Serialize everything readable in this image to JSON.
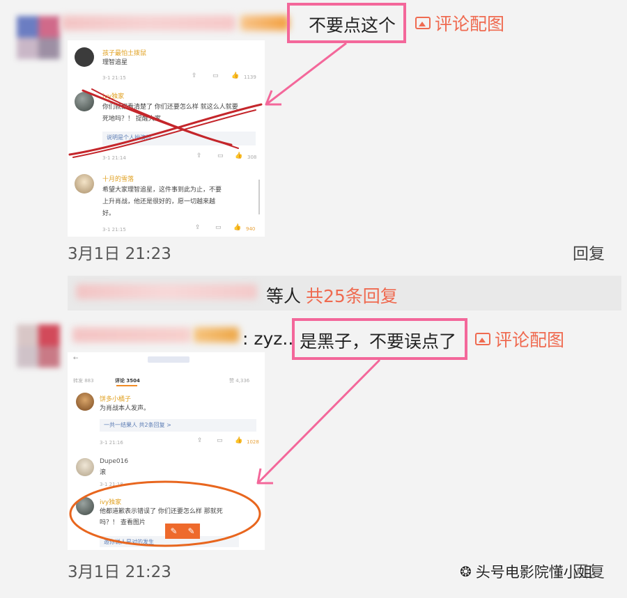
{
  "comment1": {
    "reply_text": "不要点这个",
    "pic_link": "评论配图",
    "date": "3月1日 21:23",
    "reply_button": "回复",
    "screenshot": {
      "items": [
        {
          "name": "孩子最怕土拨鼠",
          "text": "理智追星",
          "meta": "3-1 21:15",
          "likes": "1139"
        },
        {
          "name": "ivy独家",
          "text": "你们就都看清楚了 你们还要怎么样 就这么人就要",
          "text2": "死地吗？！ 提醒大家",
          "quote": "说明是个人扮演的",
          "meta": "3-1 21:14",
          "likes": "308"
        },
        {
          "name": "十月的雪落",
          "text": "希望大家理智追星，这件事到此为止，不要",
          "text2": "上升肖战，他还是很好的，愿一切越来越",
          "text3": "好。",
          "meta": "3-1 21:15",
          "likes": "940"
        }
      ]
    }
  },
  "replies_bar": {
    "suffix": "等人",
    "count": "共25条回复"
  },
  "comment2": {
    "prefix": ": zyz..",
    "reply_text": "是黑子，不要误点了",
    "pic_link": "评论配图",
    "date": "3月1日 21:23",
    "reply_button": "回复",
    "screenshot": {
      "tabs": [
        "转发 883",
        "评论 3504",
        "赞 4,336"
      ],
      "items": [
        {
          "name": "饼多小橘子",
          "text": "为肖战本人发声。",
          "quote": "一共一结果人 共2条回复 >",
          "meta": "3-1 21:16",
          "likes": "1028"
        },
        {
          "name": "Dupe016",
          "text": "滚",
          "meta": "3-1 21:18",
          "likes": ""
        },
        {
          "name": "ivy独家",
          "text": "他都道歉表示错误了 你们还要怎么样 那就死",
          "text2": "吗？！ 查看图片",
          "quote": "邀你说人是对的发生",
          "meta": "",
          "likes": ""
        }
      ]
    }
  },
  "watermark": {
    "text": "头号电影院懂小姐"
  },
  "colors": {
    "accent_orange": "#ef6a50",
    "highlight_pink": "#f3679a",
    "cross_red": "#c4262b",
    "circle_orange": "#e8661e"
  }
}
